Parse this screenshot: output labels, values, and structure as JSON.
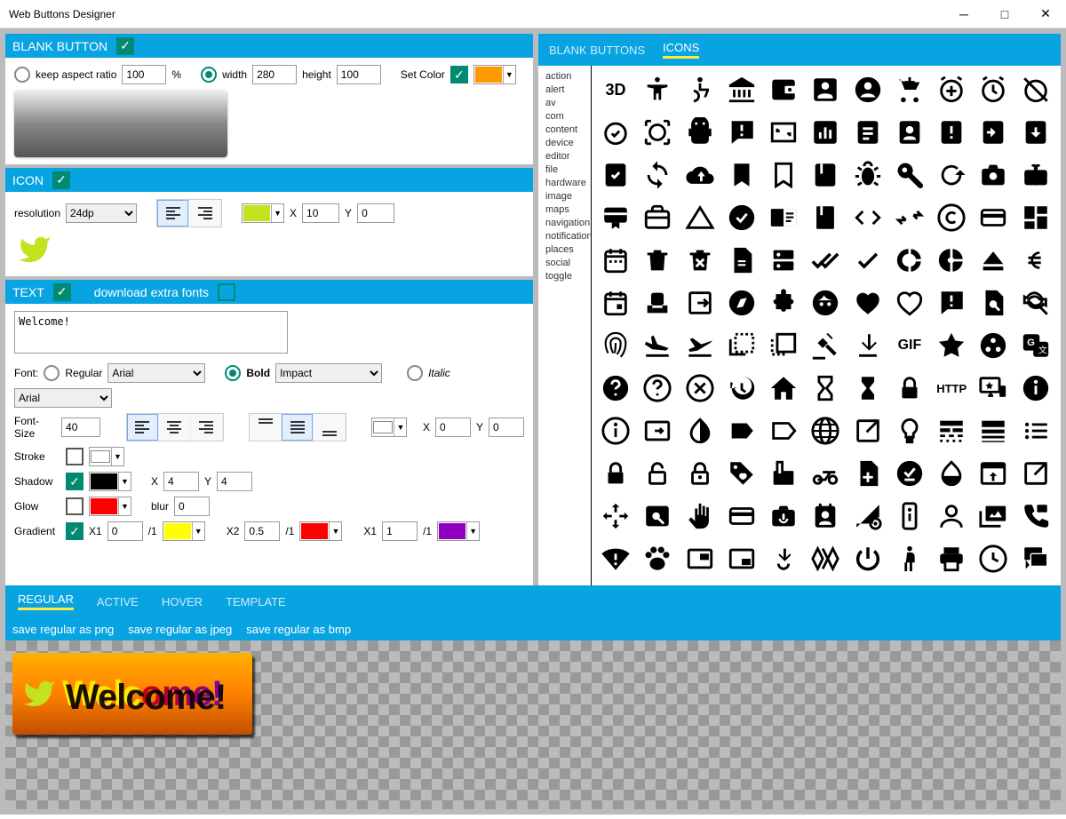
{
  "window": {
    "title": "Web Buttons Designer"
  },
  "blank": {
    "header": "BLANK BUTTON",
    "keep_aspect": "keep aspect ratio",
    "aspect_val": "100",
    "aspect_pct": "%",
    "width_lbl": "width",
    "width_val": "280",
    "height_lbl": "height",
    "height_val": "100",
    "setcolor": "Set Color",
    "color": "#ff9900"
  },
  "icon": {
    "header": "ICON",
    "res_lbl": "resolution",
    "res_val": "24dp",
    "color": "#c4e21e",
    "x_lbl": "X",
    "x_val": "10",
    "y_lbl": "Y",
    "y_val": "0"
  },
  "text": {
    "header": "TEXT",
    "extra_fonts": "download extra fonts",
    "value": "Welcome!",
    "font_lbl": "Font:",
    "regular_lbl": "Regular",
    "regular_font": "Arial",
    "bold_lbl": "Bold",
    "bold_font": "Impact",
    "italic_lbl": "Italic",
    "second_font": "Arial",
    "size_lbl": "Font-Size",
    "size_val": "40",
    "x_lbl": "X",
    "x_val": "0",
    "y_lbl": "Y",
    "y_val": "0",
    "stroke_lbl": "Stroke",
    "shadow_lbl": "Shadow",
    "shadow_color": "#000000",
    "sh_x_lbl": "X",
    "sh_x": "4",
    "sh_y_lbl": "Y",
    "sh_y": "4",
    "glow_lbl": "Glow",
    "glow_color": "#ff0000",
    "blur_lbl": "blur",
    "blur_val": "0",
    "grad_lbl": "Gradient",
    "x1_lbl": "X1",
    "x1_val": "0",
    "x1_div": "/1",
    "c1": "#ffff00",
    "x2_lbl": "X2",
    "x2_val": "0.5",
    "x2_div": "/1",
    "c2": "#ff0000",
    "x3_lbl": "X1",
    "x3_val": "1",
    "x3_div": "/1",
    "c3": "#9000c0"
  },
  "tabs": {
    "t1": "BLANK BUTTONS",
    "t2": "ICONS"
  },
  "cats": [
    "action",
    "alert",
    "av",
    "com",
    "content",
    "device",
    "editor",
    "file",
    "hardware",
    "image",
    "maps",
    "navigation",
    "notification",
    "places",
    "social",
    "toggle"
  ],
  "bottom": {
    "tabs": [
      "REGULAR",
      "ACTIVE",
      "HOVER",
      "TEMPLATE"
    ],
    "saves": [
      "save regular as png",
      "save regular as jpeg",
      "save regular as bmp"
    ],
    "preview_text": "Welcome!"
  }
}
